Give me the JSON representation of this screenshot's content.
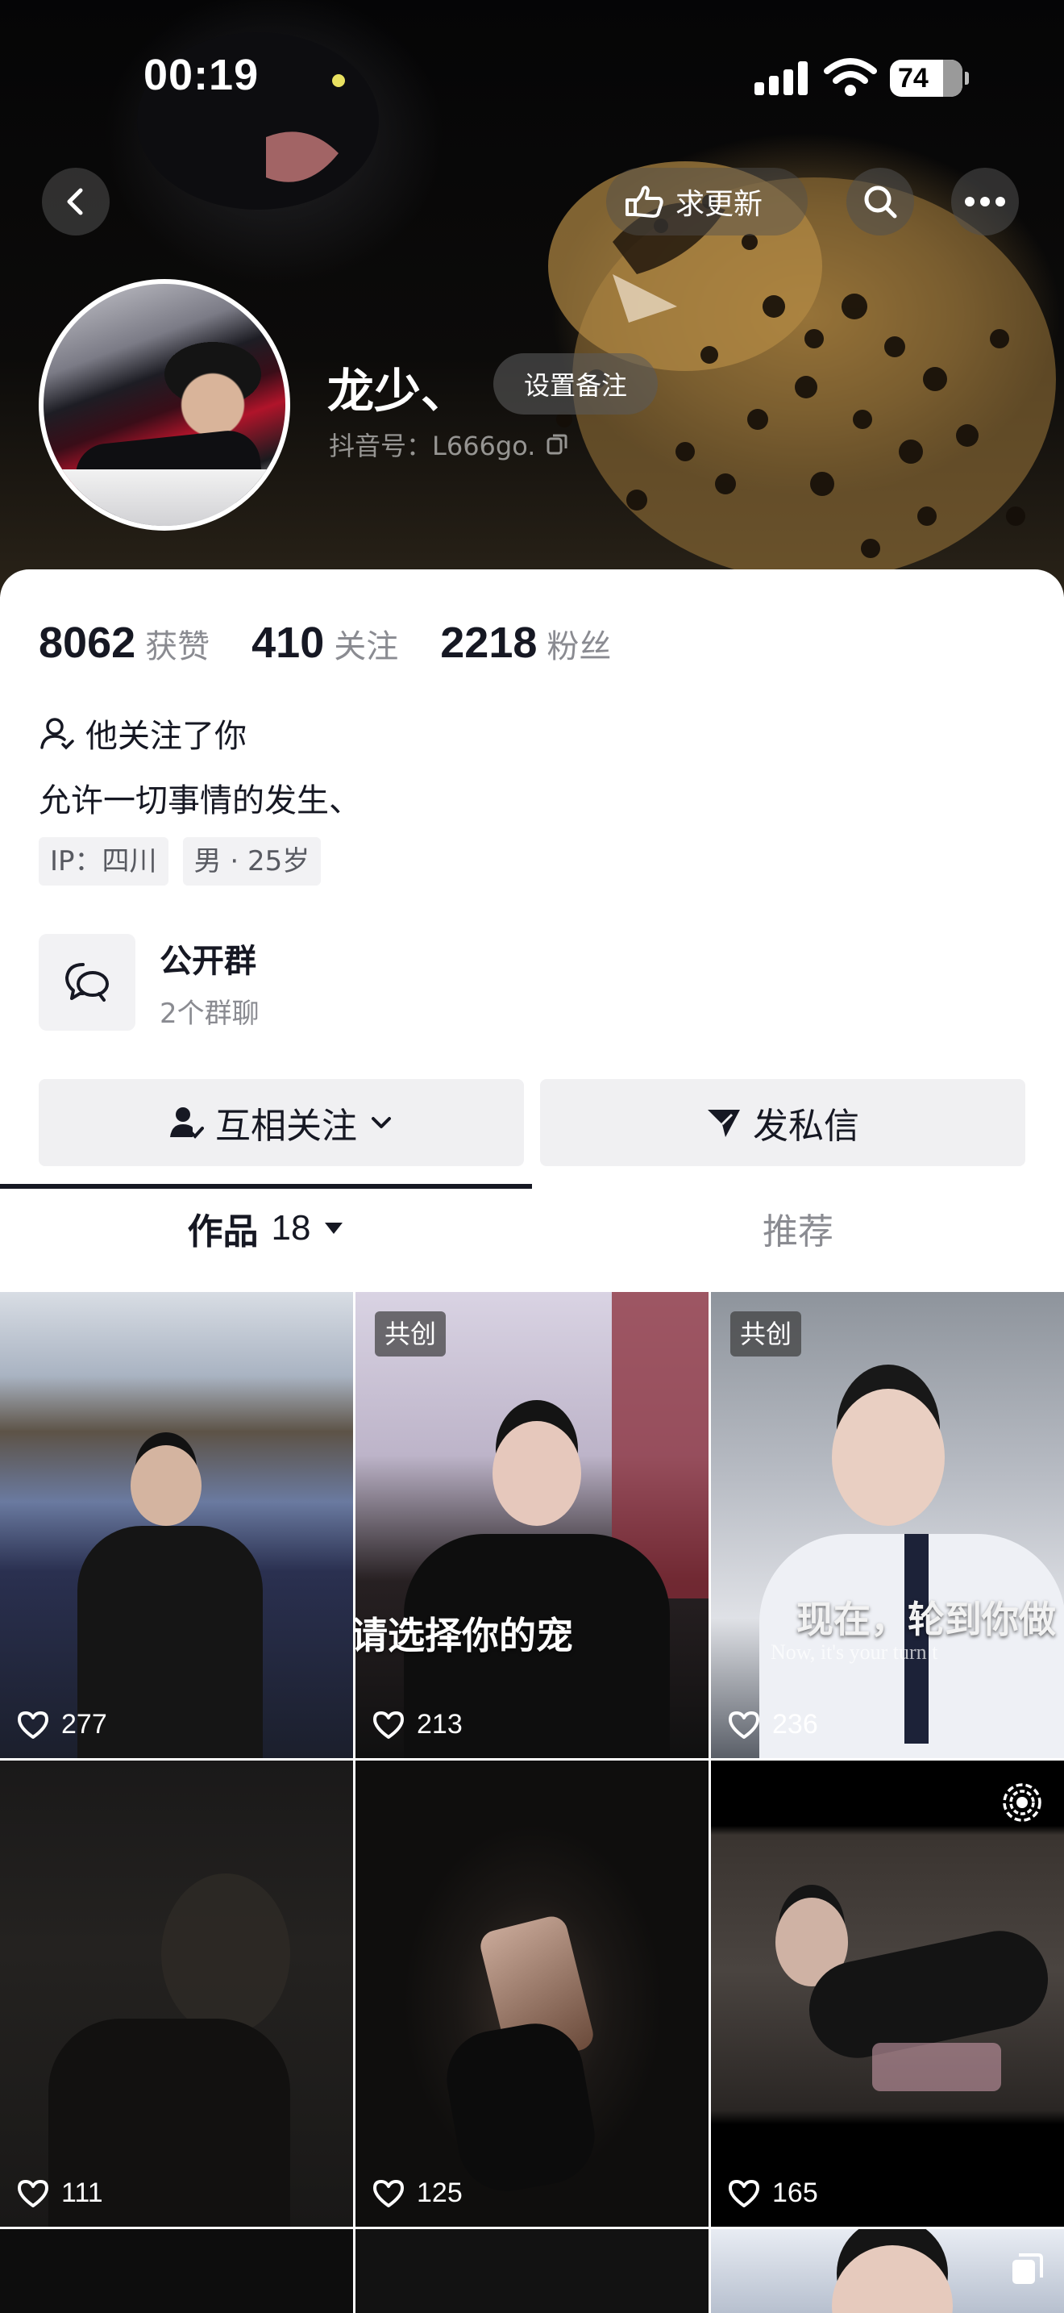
{
  "status_bar": {
    "time": "00:19",
    "battery": "74"
  },
  "header": {
    "update_label": "求更新",
    "nickname": "龙少、",
    "remark_label": "设置备注",
    "douyin_id": "抖音号：L666go."
  },
  "stats": [
    {
      "value": "8062",
      "label": "获赞"
    },
    {
      "value": "410",
      "label": "关注"
    },
    {
      "value": "2218",
      "label": "粉丝"
    }
  ],
  "profile": {
    "follows_you": "他关注了你",
    "bio": "允许一切事情的发生、",
    "tags": [
      "IP：四川",
      "男 · 25岁"
    ]
  },
  "group": {
    "title": "公开群",
    "subtitle": "2个群聊"
  },
  "actions": {
    "follow_label": "互相关注",
    "message_label": "发私信"
  },
  "tabs": {
    "works_label": "作品",
    "works_count": "18",
    "recommend_label": "推荐"
  },
  "videos": [
    {
      "likes": "277",
      "badge": ""
    },
    {
      "likes": "213",
      "badge": "共创",
      "caption": "请选择你的宠"
    },
    {
      "likes": "236",
      "badge": "共创",
      "caption": "现在，轮到你做",
      "caption_en": "Now, it's your turn t"
    },
    {
      "likes": "111",
      "badge": ""
    },
    {
      "likes": "125",
      "badge": ""
    },
    {
      "likes": "165",
      "badge": ""
    }
  ],
  "colors": {
    "text_primary": "#161823",
    "text_secondary": "#8a8b91",
    "button_bg": "#f0f0f2"
  }
}
